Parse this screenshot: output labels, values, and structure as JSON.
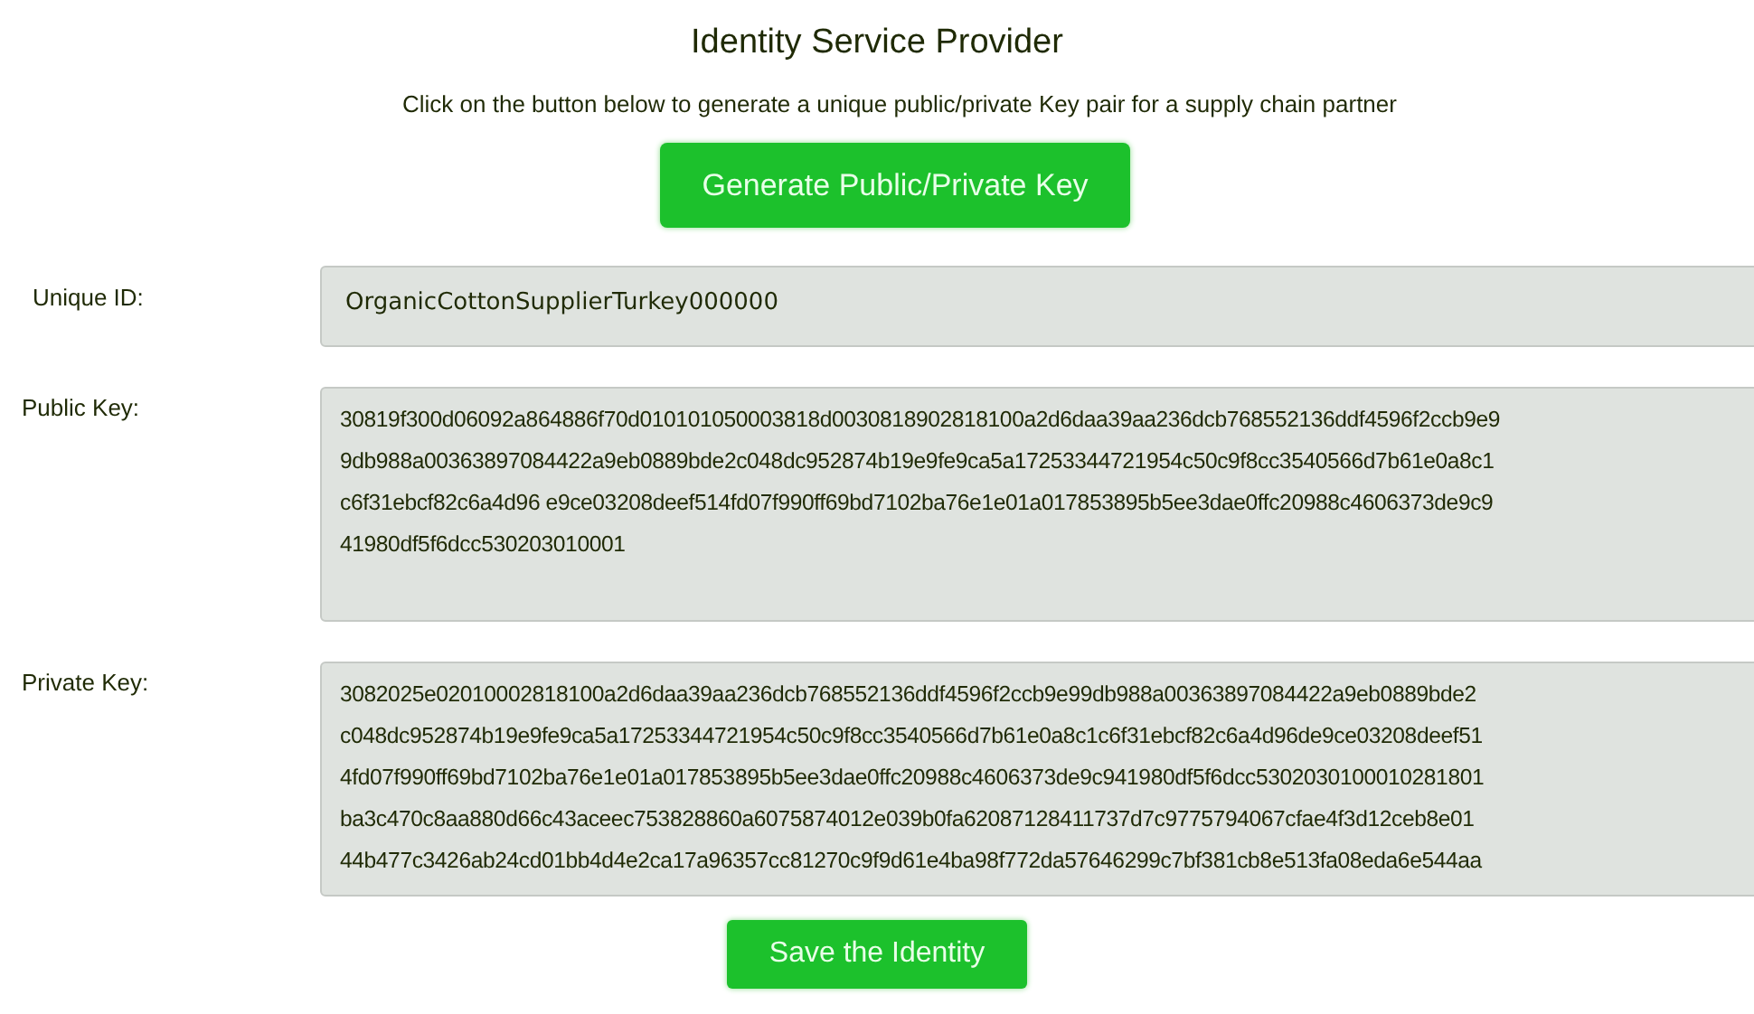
{
  "title": "Identity Service Provider",
  "instruction": "Click on the button below to generate a unique public/private Key pair for a supply chain partner",
  "generate_button": "Generate Public/Private Key",
  "fields": [
    {
      "label": "Unique ID:",
      "lines": [
        "OrganicCottonSupplierTurkey000000"
      ]
    },
    {
      "label": "Public Key:",
      "lines": [
        "30819f300d06092a864886f70d010101050003818d0030818902818100a2d6daa39aa236dcb768552136ddf4596f2ccb9e9",
        "9db988a00363897084422a9eb0889bde2c048dc952874b19e9fe9ca5a17253344721954c50c9f8cc3540566d7b61e0a8c1",
        "c6f31ebcf82c6a4d96 e9ce03208deef514fd07f990ff69bd7102ba76e1e01a017853895b5ee3dae0ffc20988c4606373de9c9",
        "41980df5f6dcc530203010001"
      ]
    },
    {
      "label": "Private Key:",
      "lines": [
        "3082025e02010002818100a2d6daa39aa236dcb768552136ddf4596f2ccb9e99db988a00363897084422a9eb0889bde2",
        "c048dc952874b19e9fe9ca5a17253344721954c50c9f8cc3540566d7b61e0a8c1c6f31ebcf82c6a4d96de9ce03208deef51",
        "4fd07f990ff69bd7102ba76e1e01a017853895b5ee3dae0ffc20988c4606373de9c941980df5f6dcc5302030100010281801",
        "ba3c470c8aa880d66c43aceec753828860a6075874012e039b0fa62087128411737d7c9775794067cfae4f3d12ceb8e01",
        "44b477c3426ab24cd01bb4d4e2ca17a96357cc81270c9f9d61e4ba98f772da57646299c7bf381cb8e513fa08eda6e544aa"
      ]
    }
  ],
  "save_button": "Save the Identity"
}
